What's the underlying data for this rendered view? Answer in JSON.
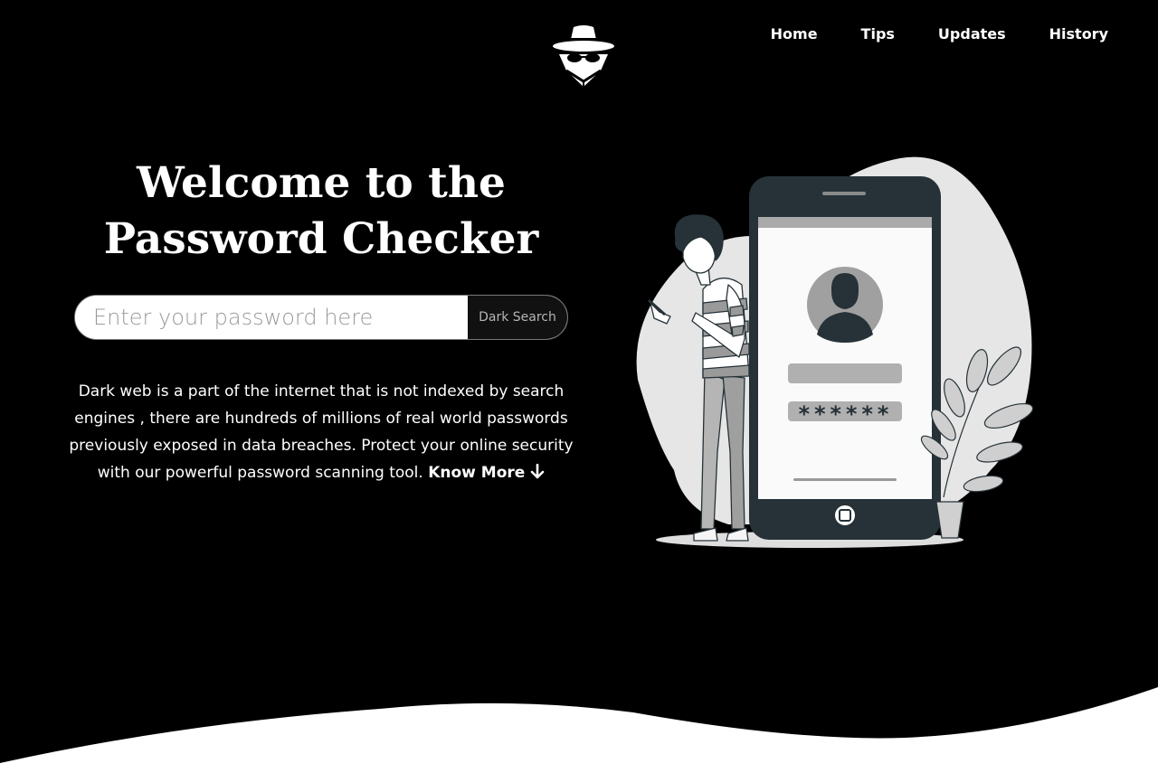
{
  "header": {
    "logo_icon": "spy-hat-glasses-icon",
    "nav": [
      {
        "label": "Home"
      },
      {
        "label": "Tips"
      },
      {
        "label": "Updates"
      },
      {
        "label": "History"
      }
    ]
  },
  "hero": {
    "title_line1": "Welcome to the",
    "title_line2": "Password Checker",
    "search": {
      "placeholder": "Enter your password here",
      "value": "",
      "button_label": "Dark Search"
    },
    "description": "Dark web is a part of the internet that is not indexed by search engines , there are hundreds of millions of real world passwords previously exposed in data breaches. Protect your online security with our powerful password scanning tool.",
    "know_more_label": "Know More",
    "know_more_icon": "arrow-down-icon"
  },
  "illustration": {
    "masked_password": "******"
  },
  "colors": {
    "background": "#000000",
    "text": "#ffffff",
    "wave": "#ffffff",
    "phone_body": "#263238",
    "illustration_gray": "#e0e0e0"
  }
}
